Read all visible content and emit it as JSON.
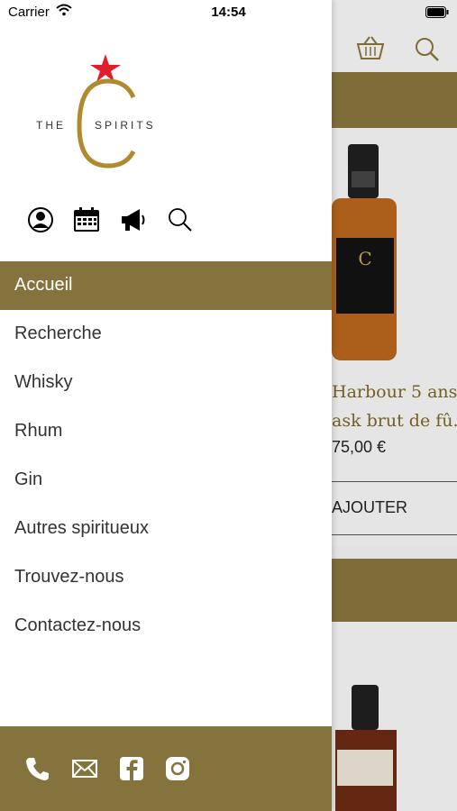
{
  "status_bar": {
    "carrier": "Carrier",
    "time": "14:54"
  },
  "logo": {
    "letter": "C",
    "word_left": "THE",
    "word_right": "SPIRITS"
  },
  "menu": {
    "items": [
      {
        "label": "Accueil",
        "active": true
      },
      {
        "label": "Recherche"
      },
      {
        "label": "Whisky"
      },
      {
        "label": "Rhum"
      },
      {
        "label": "Gin"
      },
      {
        "label": "Autres spiritueux"
      },
      {
        "label": "Trouvez-nous"
      },
      {
        "label": "Contactez-nous"
      }
    ]
  },
  "background": {
    "product_title_line1": "Harbour 5 ans",
    "product_title_line2": "ask brut de fû.",
    "price": "75,00 €",
    "add_button": "AJOUTER"
  },
  "colors": {
    "accent": "#85733d",
    "star": "#e01e2b",
    "logo_gold": "#b08a2e"
  },
  "icons": [
    "user-icon",
    "calendar-icon",
    "megaphone-icon",
    "search-icon",
    "phone-icon",
    "mail-icon",
    "facebook-icon",
    "instagram-icon",
    "basket-icon"
  ]
}
